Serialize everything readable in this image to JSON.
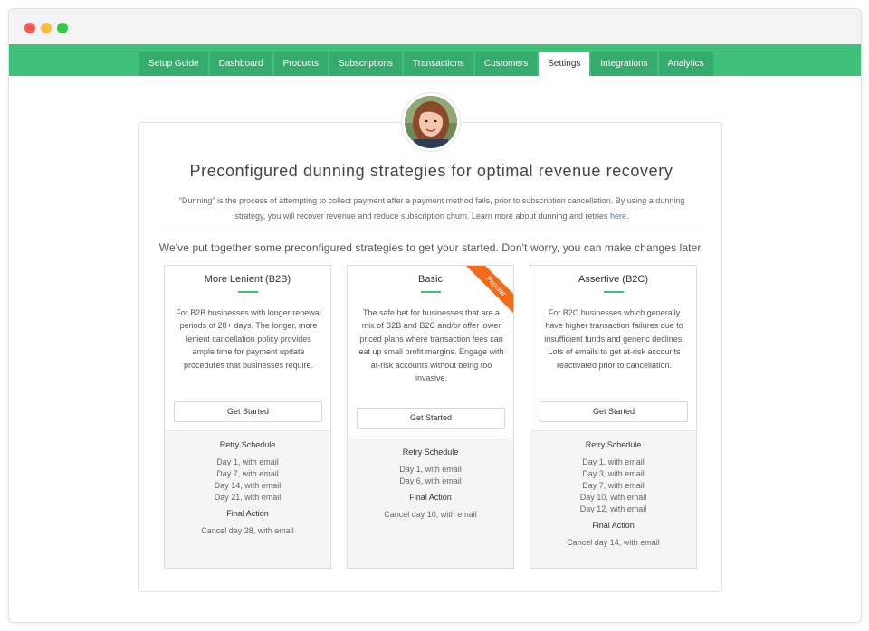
{
  "nav": {
    "tabs": [
      {
        "label": "Setup Guide"
      },
      {
        "label": "Dashboard"
      },
      {
        "label": "Products"
      },
      {
        "label": "Subscriptions"
      },
      {
        "label": "Transactions"
      },
      {
        "label": "Customers"
      },
      {
        "label": "Settings",
        "active": true
      },
      {
        "label": "Integrations"
      },
      {
        "label": "Analytics"
      }
    ]
  },
  "colors": {
    "accent": "#3fc07b",
    "tab": "#36ac6c",
    "ribbon": "#f26a1b",
    "link": "#2a7ae2"
  },
  "page": {
    "heading": "Preconfigured dunning strategies for optimal revenue recovery",
    "description": "\"Dunning\" is the process of attempting to collect payment after a payment method fails, prior to subscription cancellation. By using a dunning strategy, you will recover revenue and reduce subscription churn. Learn more about dunning and retries",
    "link_text": "here",
    "intro": "We've put together some preconfigured strategies to get your started. Don't worry, you can make changes later."
  },
  "cards": [
    {
      "title": "More Lenient (B2B)",
      "description": "For B2B businesses with longer renewal periods of 28+ days. The longer, more lenient cancellation policy provides ample time for payment update procedures that businesses require.",
      "button": "Get Started",
      "schedule_title": "Retry Schedule",
      "schedule": [
        "Day 1, with email",
        "Day 7, with email",
        "Day 14, with email",
        "Day 21, with email"
      ],
      "final_title": "Final Action",
      "final_action": "Cancel day 28, with email"
    },
    {
      "title": "Basic",
      "badge": "Popular",
      "description": "The safe bet for businesses that are a mix of B2B and B2C and/or offer lower priced plans where transaction fees can eat up small profit margins. Engage with at-risk accounts without being too invasive.",
      "button": "Get Started",
      "schedule_title": "Retry Schedule",
      "schedule": [
        "Day 1, with email",
        "Day 6, with email"
      ],
      "final_title": "Final Action",
      "final_action": "Cancel day 10, with email"
    },
    {
      "title": "Assertive (B2C)",
      "description": "For B2C businesses which generally have higher transaction failures due to insufficient funds and generic declines. Lots of emails to get at-risk accounts reactivated prior to cancellation.",
      "button": "Get Started",
      "schedule_title": "Retry Schedule",
      "schedule": [
        "Day 1, with email",
        "Day 3, with email",
        "Day 7, with email",
        "Day 10, with email",
        "Day 12, with email"
      ],
      "final_title": "Final Action",
      "final_action": "Cancel day 14, with email"
    }
  ]
}
